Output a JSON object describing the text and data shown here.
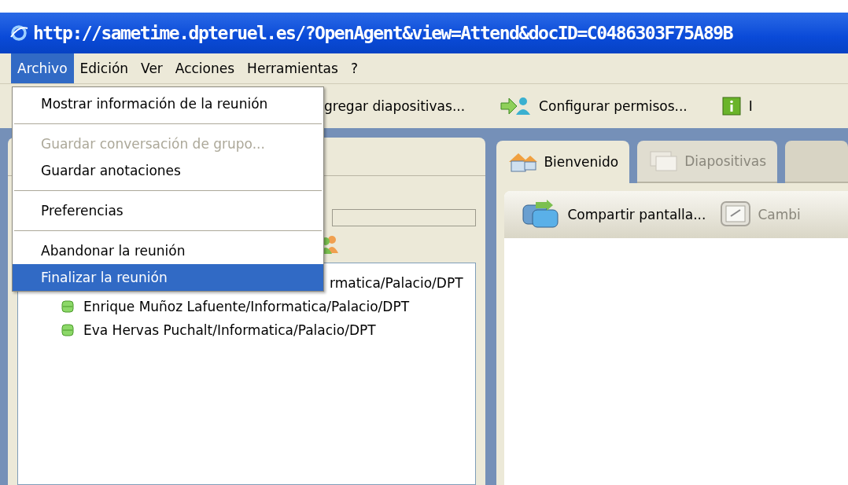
{
  "window": {
    "title": "http://sametime.dpteruel.es/?OpenAgent&view=Attend&docID=C0486303F75A89B"
  },
  "menubar": [
    {
      "label": "Archivo",
      "selected": true
    },
    {
      "label": "Edición",
      "selected": false
    },
    {
      "label": "Ver",
      "selected": false
    },
    {
      "label": "Acciones",
      "selected": false
    },
    {
      "label": "Herramientas",
      "selected": false
    },
    {
      "label": "?",
      "selected": false
    }
  ],
  "menu": {
    "groups": [
      [
        {
          "label": "Mostrar información de la reunión",
          "disabled": false,
          "selected": false
        }
      ],
      [
        {
          "label": "Guardar conversación de grupo...",
          "disabled": true,
          "selected": false
        },
        {
          "label": "Guardar anotaciones",
          "disabled": false,
          "selected": false
        }
      ],
      [
        {
          "label": "Preferencias",
          "disabled": false,
          "selected": false
        }
      ],
      [
        {
          "label": "Abandonar la reunión",
          "disabled": false,
          "selected": false
        },
        {
          "label": "Finalizar la reunión",
          "disabled": false,
          "selected": true
        }
      ]
    ]
  },
  "toolbar": [
    "gregar diapositivas...",
    "Configurar permisos...",
    "I"
  ],
  "participants": [
    {
      "name": "rmatica/Palacio/DPT",
      "status": false
    },
    {
      "name": "Enrique Muñoz Lafuente/Informatica/Palacio/DPT",
      "status": true
    },
    {
      "name": "Eva Hervas Puchalt/Informatica/Palacio/DPT",
      "status": true
    }
  ],
  "tabs": [
    {
      "label": "Bienvenido",
      "selected": true,
      "disabled": false
    },
    {
      "label": "Diapositivas",
      "selected": false,
      "disabled": true
    },
    {
      "selected": false,
      "disabled": false
    }
  ],
  "share_toolbar": [
    {
      "label": "Compartir pantalla...",
      "disabled": false
    },
    {
      "label": "Cambi",
      "disabled": true
    }
  ]
}
